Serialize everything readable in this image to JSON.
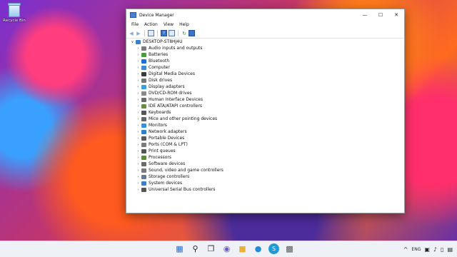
{
  "desktop": {
    "recycle_bin_label": "Recycle Bin"
  },
  "window": {
    "title": "Device Manager",
    "controls": {
      "minimize": "—",
      "maximize": "☐",
      "close": "✕"
    },
    "menu": [
      "File",
      "Action",
      "View",
      "Help"
    ],
    "tree": {
      "root": "DESKTOP-ST8HJ4U",
      "items": [
        {
          "label": "Audio inputs and outputs",
          "icon": "audio-icon",
          "color": "#7a7a7a"
        },
        {
          "label": "Batteries",
          "icon": "battery-icon",
          "color": "#4a9d3d"
        },
        {
          "label": "Bluetooth",
          "icon": "bluetooth-icon",
          "color": "#1f6fd6"
        },
        {
          "label": "Computer",
          "icon": "computer-icon",
          "color": "#3c8ad8"
        },
        {
          "label": "Digital Media Devices",
          "icon": "media-device-icon",
          "color": "#3a3a3a"
        },
        {
          "label": "Disk drives",
          "icon": "disk-drive-icon",
          "color": "#777777"
        },
        {
          "label": "Display adapters",
          "icon": "display-adapter-icon",
          "color": "#3ba0d6"
        },
        {
          "label": "DVD/CD-ROM drives",
          "icon": "dvd-drive-icon",
          "color": "#8a8a8a"
        },
        {
          "label": "Human Interface Devices",
          "icon": "hid-icon",
          "color": "#6b6b6b"
        },
        {
          "label": "IDE ATA/ATAPI controllers",
          "icon": "ide-controller-icon",
          "color": "#6a8a4a"
        },
        {
          "label": "Keyboards",
          "icon": "keyboard-icon",
          "color": "#555555"
        },
        {
          "label": "Mice and other pointing devices",
          "icon": "mouse-icon",
          "color": "#666666"
        },
        {
          "label": "Monitors",
          "icon": "monitor-icon",
          "color": "#3b8fd8"
        },
        {
          "label": "Network adapters",
          "icon": "network-adapter-icon",
          "color": "#2f7fcf"
        },
        {
          "label": "Portable Devices",
          "icon": "portable-device-icon",
          "color": "#5a5a5a"
        },
        {
          "label": "Ports (COM & LPT)",
          "icon": "port-icon",
          "color": "#7a7a7a"
        },
        {
          "label": "Print queues",
          "icon": "printer-icon",
          "color": "#555555"
        },
        {
          "label": "Processors",
          "icon": "processor-icon",
          "color": "#5a8a3a"
        },
        {
          "label": "Software devices",
          "icon": "software-device-icon",
          "color": "#6a6a6a"
        },
        {
          "label": "Sound, video and game controllers",
          "icon": "sound-icon",
          "color": "#7a7a7a"
        },
        {
          "label": "Storage controllers",
          "icon": "storage-controller-icon",
          "color": "#6a7a8a"
        },
        {
          "label": "System devices",
          "icon": "system-device-icon",
          "color": "#3c7fcf"
        },
        {
          "label": "Universal Serial Bus controllers",
          "icon": "usb-icon",
          "color": "#555555"
        }
      ]
    }
  },
  "taskbar": {
    "apps": [
      "start-icon",
      "search-icon",
      "task-view-icon",
      "chat-icon",
      "file-explorer-icon",
      "edge-icon",
      "skype-icon",
      "device-manager-icon"
    ],
    "tray": {
      "chevron": "^",
      "language": "ENG"
    }
  }
}
